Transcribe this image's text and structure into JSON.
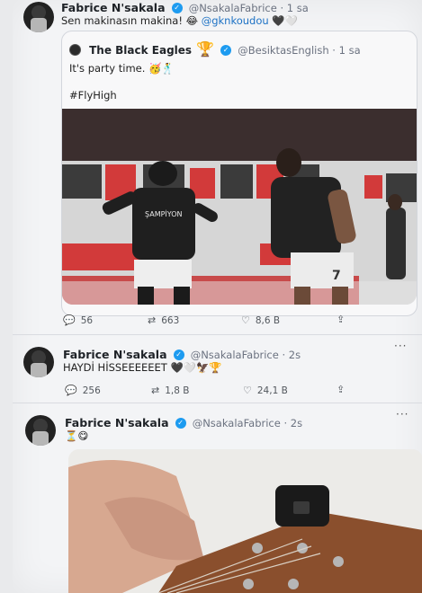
{
  "tweet1": {
    "name": "Fabrice N'sakala",
    "handle": "@NsakalaFabrice · 1 sa",
    "text_prefix": "Sen makinasın makina! 😂 ",
    "mention": "@gknkoudou",
    "hearts": "🖤🤍"
  },
  "quote": {
    "name": "The Black Eagles",
    "trophy": "🏆",
    "handle": "@BesiktasEnglish · 1 sa",
    "text": "It's party time. 🥳🕺",
    "hashtag": "#FlyHigh",
    "jersey_number": "7",
    "shirt_text": "ŞAMPİYON"
  },
  "tweet1_actions": {
    "reply_icon": "reply-icon",
    "reply_count": "56",
    "retweet_icon": "retweet-icon",
    "retweet_count": "663",
    "like_icon": "heart-icon",
    "like_count": "8,6 B",
    "share_icon": "share-icon"
  },
  "tweet2": {
    "name": "Fabrice N'sakala",
    "handle": "@NsakalaFabrice · 2s",
    "text": "HAYDİ HİSSEEEEEET",
    "emojis": "🖤🤍🦅🏆",
    "more": "···",
    "reply_count": "256",
    "retweet_count": "1,8 B",
    "like_count": "24,1 B"
  },
  "tweet3": {
    "name": "Fabrice N'sakala",
    "handle": "@NsakalaFabrice · 2s",
    "text": "⏳😋",
    "more": "···"
  },
  "colors": {
    "link": "#1d72c5",
    "verified": "#1d9bf0",
    "background": "#f3f4f6"
  }
}
